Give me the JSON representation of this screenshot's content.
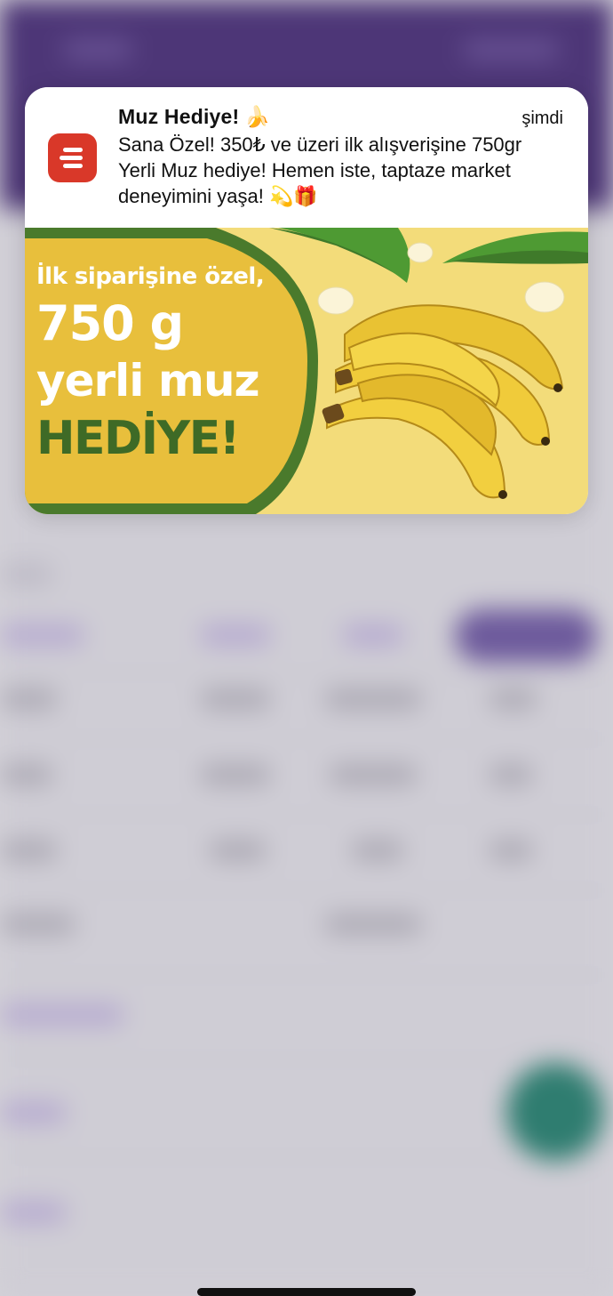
{
  "notification": {
    "app_icon": "stacked-lines-icon",
    "title": "Muz Hediye!",
    "title_emoji": "🍌",
    "time": "şimdi",
    "body": "Sana Özel! 350₺ ve üzeri ilk alışverişine 750gr Yerli Muz hediye! Hemen iste, taptaze market deneyimini yaşa! 💫🎁",
    "accent_color": "#d93829"
  },
  "promo": {
    "line1": "İlk siparişine özel,",
    "line2": "750 g",
    "line3": "yerli muz",
    "line4": "HEDİYE!",
    "green": "#3e6a26",
    "panel_color": "#e8bf3c",
    "background": "#f3dc7a"
  }
}
